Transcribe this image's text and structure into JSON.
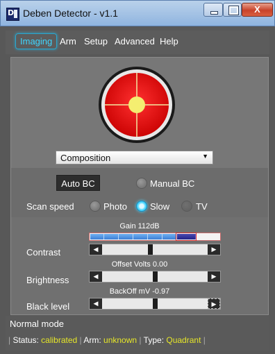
{
  "window": {
    "title": "Deben Detector - v1.1",
    "icon_letters": "D",
    "buttons": {
      "minimize": "minimize-icon",
      "maximize": "maximize-icon",
      "close": "X"
    }
  },
  "menu": {
    "items": [
      "Imaging",
      "Arm",
      "Setup",
      "Advanced",
      "Help"
    ],
    "active": "Imaging"
  },
  "imaging": {
    "target_icon": "crosshair-target-icon",
    "mode_select": {
      "value": "Composition"
    },
    "brightness_contrast": {
      "auto_label": "Auto BC",
      "manual_label": "Manual BC"
    },
    "scan_speed": {
      "label": "Scan speed",
      "options": [
        "Photo",
        "Slow",
        "TV"
      ],
      "selected": "Slow"
    },
    "gain": {
      "caption": "Gain 112dB"
    },
    "contrast": {
      "label": "Contrast"
    },
    "offset": {
      "caption": "Offset Volts 0.00"
    },
    "brightness": {
      "label": "Brightness"
    },
    "backoff": {
      "caption": "BackOff mV -0.97"
    },
    "black_level": {
      "label": "Black level"
    }
  },
  "status": {
    "mode": "Normal mode",
    "status_label": "Status:",
    "status_value": "calibrated",
    "arm_label": "Arm:",
    "arm_value": "unknown",
    "type_label": "Type:",
    "type_value": "Quadrant",
    "separator": "|"
  },
  "colors": {
    "accent": "#3fd6ff",
    "status_value": "#e6e629",
    "target_red": "#e01010",
    "target_center": "#f4ee70"
  }
}
